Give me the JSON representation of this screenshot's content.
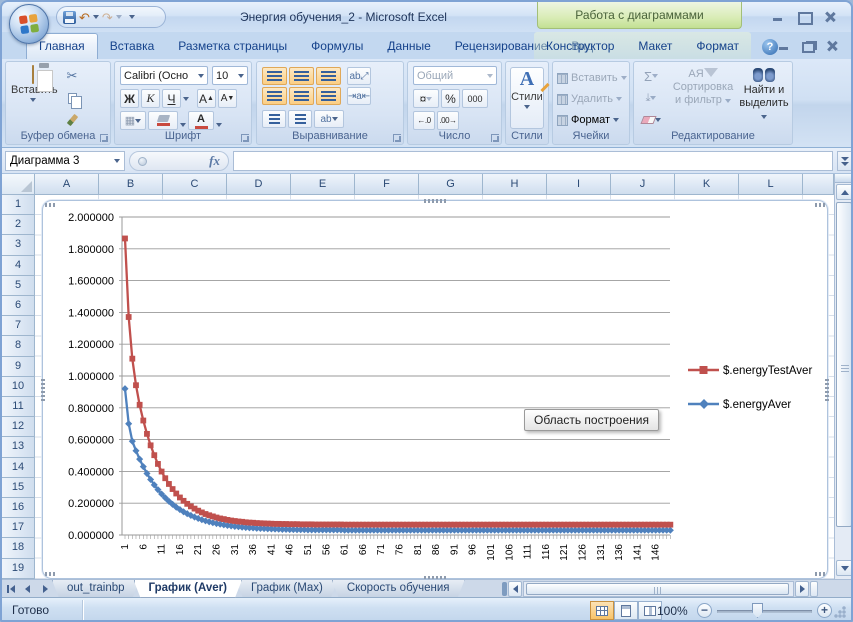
{
  "window": {
    "title": "Энергия обучения_2 - Microsoft Excel",
    "contextual_header": "Работа с диаграммами"
  },
  "ribbon": {
    "tabs": [
      {
        "label": "Главная",
        "active": true
      },
      {
        "label": "Вставка"
      },
      {
        "label": "Разметка страницы"
      },
      {
        "label": "Формулы"
      },
      {
        "label": "Данные"
      },
      {
        "label": "Рецензирование"
      },
      {
        "label": "Вид"
      }
    ],
    "contextual_tabs": [
      {
        "label": "Конструктор"
      },
      {
        "label": "Макет"
      },
      {
        "label": "Формат"
      }
    ],
    "groups": {
      "clipboard": {
        "label": "Буфер обмена",
        "paste_label": "Вставить"
      },
      "font": {
        "label": "Шрифт",
        "font_name": "Calibri (Осно",
        "font_size": "10",
        "bold": "Ж",
        "italic": "К",
        "underline": "Ч",
        "grow": "А",
        "shrink": "А",
        "color_letter": "А"
      },
      "alignment": {
        "label": "Выравнивание"
      },
      "number": {
        "label": "Число",
        "format": "Общий",
        "percent": "%",
        "thousands": "000",
        "currency": "¤",
        "dec_inc": "←.0",
        "dec_dec": ".00→"
      },
      "styles": {
        "label": "Стили",
        "button_label": "Стили",
        "letter": "A"
      },
      "cells": {
        "label": "Ячейки",
        "insert": "Вставить",
        "delete": "Удалить",
        "format": "Формат"
      },
      "editing": {
        "label": "Редактирование",
        "sigma": "Σ",
        "az1": "А",
        "az2": "Я",
        "sort_line1": "Сортировка",
        "sort_line2": "и фильтр",
        "find_line1": "Найти и",
        "find_line2": "выделить"
      }
    }
  },
  "formula_bar": {
    "name_box": "Диаграмма 3",
    "fx": "fx",
    "formula": ""
  },
  "sheet": {
    "columns": [
      "A",
      "B",
      "C",
      "D",
      "E",
      "F",
      "G",
      "H",
      "I",
      "J",
      "K",
      "L"
    ],
    "rows": [
      "1",
      "2",
      "3",
      "4",
      "5",
      "6",
      "7",
      "8",
      "9",
      "10",
      "11",
      "12",
      "13",
      "14",
      "15",
      "16",
      "17",
      "18",
      "19"
    ]
  },
  "chart_data": {
    "type": "line",
    "title": "",
    "xlabel": "",
    "ylabel": "",
    "ylim": [
      0,
      2.0
    ],
    "ytick_labels": [
      "2.000000",
      "1.800000",
      "1.600000",
      "1.400000",
      "1.200000",
      "1.000000",
      "0.800000",
      "0.600000",
      "0.400000",
      "0.200000",
      "0.000000"
    ],
    "x_range": [
      1,
      150
    ],
    "xtick_labels": [
      1,
      6,
      11,
      16,
      21,
      26,
      31,
      36,
      41,
      46,
      51,
      56,
      61,
      66,
      71,
      76,
      81,
      86,
      91,
      96,
      101,
      106,
      111,
      116,
      121,
      126,
      131,
      136,
      141,
      146
    ],
    "grid": true,
    "legend_position": "right",
    "series": [
      {
        "name": "$.energyTestAver",
        "color": "#c0504d",
        "marker": "square",
        "values": [
          1.865,
          1.371,
          1.109,
          0.942,
          0.819,
          0.72,
          0.636,
          0.564,
          0.502,
          0.447,
          0.399,
          0.357,
          0.321,
          0.289,
          0.261,
          0.236,
          0.215,
          0.196,
          0.18,
          0.166,
          0.153,
          0.142,
          0.132,
          0.124,
          0.117,
          0.11,
          0.104,
          0.1,
          0.095,
          0.091,
          0.088,
          0.085,
          0.083,
          0.08,
          0.078,
          0.077,
          0.075,
          0.074,
          0.073,
          0.072,
          0.071,
          0.07,
          0.07,
          0.069,
          0.069,
          0.068,
          0.068,
          0.068,
          0.067,
          0.067,
          0.067,
          0.067,
          0.066,
          0.066,
          0.066,
          0.066,
          0.066,
          0.066,
          0.066,
          0.066,
          0.065,
          0.065,
          0.065,
          0.065,
          0.065,
          0.065,
          0.065,
          0.065,
          0.065,
          0.065,
          0.065,
          0.065,
          0.065,
          0.065,
          0.065,
          0.065,
          0.065,
          0.065,
          0.065,
          0.065,
          0.065,
          0.065,
          0.065,
          0.065,
          0.065,
          0.065,
          0.065,
          0.065,
          0.065,
          0.065,
          0.065,
          0.065,
          0.065,
          0.065,
          0.065,
          0.065,
          0.065,
          0.065,
          0.065,
          0.065,
          0.065,
          0.065,
          0.065,
          0.065,
          0.065,
          0.065,
          0.065,
          0.065,
          0.065,
          0.065,
          0.065,
          0.065,
          0.065,
          0.065,
          0.065,
          0.065,
          0.065,
          0.065,
          0.065,
          0.065,
          0.065,
          0.065,
          0.065,
          0.065,
          0.065,
          0.065,
          0.065,
          0.065,
          0.065,
          0.065,
          0.065,
          0.065,
          0.065,
          0.065,
          0.065,
          0.065,
          0.065,
          0.065,
          0.065,
          0.065,
          0.065,
          0.065,
          0.065,
          0.065,
          0.065,
          0.065,
          0.065,
          0.065,
          0.065,
          0.065
        ]
      },
      {
        "name": "$.energyAver",
        "color": "#4f81bd",
        "marker": "diamond",
        "values": [
          0.92,
          0.7,
          0.59,
          0.53,
          0.477,
          0.43,
          0.387,
          0.349,
          0.315,
          0.285,
          0.258,
          0.234,
          0.212,
          0.193,
          0.175,
          0.16,
          0.146,
          0.134,
          0.123,
          0.113,
          0.104,
          0.096,
          0.089,
          0.083,
          0.077,
          0.072,
          0.068,
          0.064,
          0.06,
          0.057,
          0.054,
          0.052,
          0.049,
          0.047,
          0.045,
          0.044,
          0.042,
          0.041,
          0.04,
          0.039,
          0.038,
          0.037,
          0.036,
          0.035,
          0.035,
          0.034,
          0.034,
          0.033,
          0.033,
          0.033,
          0.032,
          0.032,
          0.032,
          0.032,
          0.032,
          0.032,
          0.032,
          0.032,
          0.032,
          0.032,
          0.03,
          0.03,
          0.03,
          0.03,
          0.03,
          0.03,
          0.03,
          0.03,
          0.03,
          0.03,
          0.03,
          0.03,
          0.03,
          0.03,
          0.03,
          0.03,
          0.03,
          0.03,
          0.03,
          0.03,
          0.03,
          0.03,
          0.03,
          0.03,
          0.03,
          0.03,
          0.03,
          0.03,
          0.03,
          0.03,
          0.03,
          0.03,
          0.03,
          0.03,
          0.03,
          0.03,
          0.03,
          0.03,
          0.03,
          0.03,
          0.03,
          0.03,
          0.03,
          0.03,
          0.03,
          0.03,
          0.03,
          0.03,
          0.03,
          0.03,
          0.03,
          0.03,
          0.03,
          0.03,
          0.03,
          0.03,
          0.03,
          0.03,
          0.03,
          0.03,
          0.03,
          0.03,
          0.03,
          0.03,
          0.03,
          0.03,
          0.03,
          0.03,
          0.03,
          0.03,
          0.03,
          0.03,
          0.03,
          0.03,
          0.03,
          0.03,
          0.03,
          0.03,
          0.03,
          0.03,
          0.03,
          0.03,
          0.03,
          0.03,
          0.03,
          0.03,
          0.03,
          0.03,
          0.03,
          0.03
        ]
      }
    ]
  },
  "chart_tooltip": "Область построения",
  "sheet_tabs": {
    "tabs": [
      {
        "label": "out_trainbp"
      },
      {
        "label": "График (Aver)",
        "active": true
      },
      {
        "label": "График (Max)"
      },
      {
        "label": "Скорость обучения"
      }
    ]
  },
  "status_bar": {
    "ready": "Готово",
    "zoom_level": "100%"
  }
}
